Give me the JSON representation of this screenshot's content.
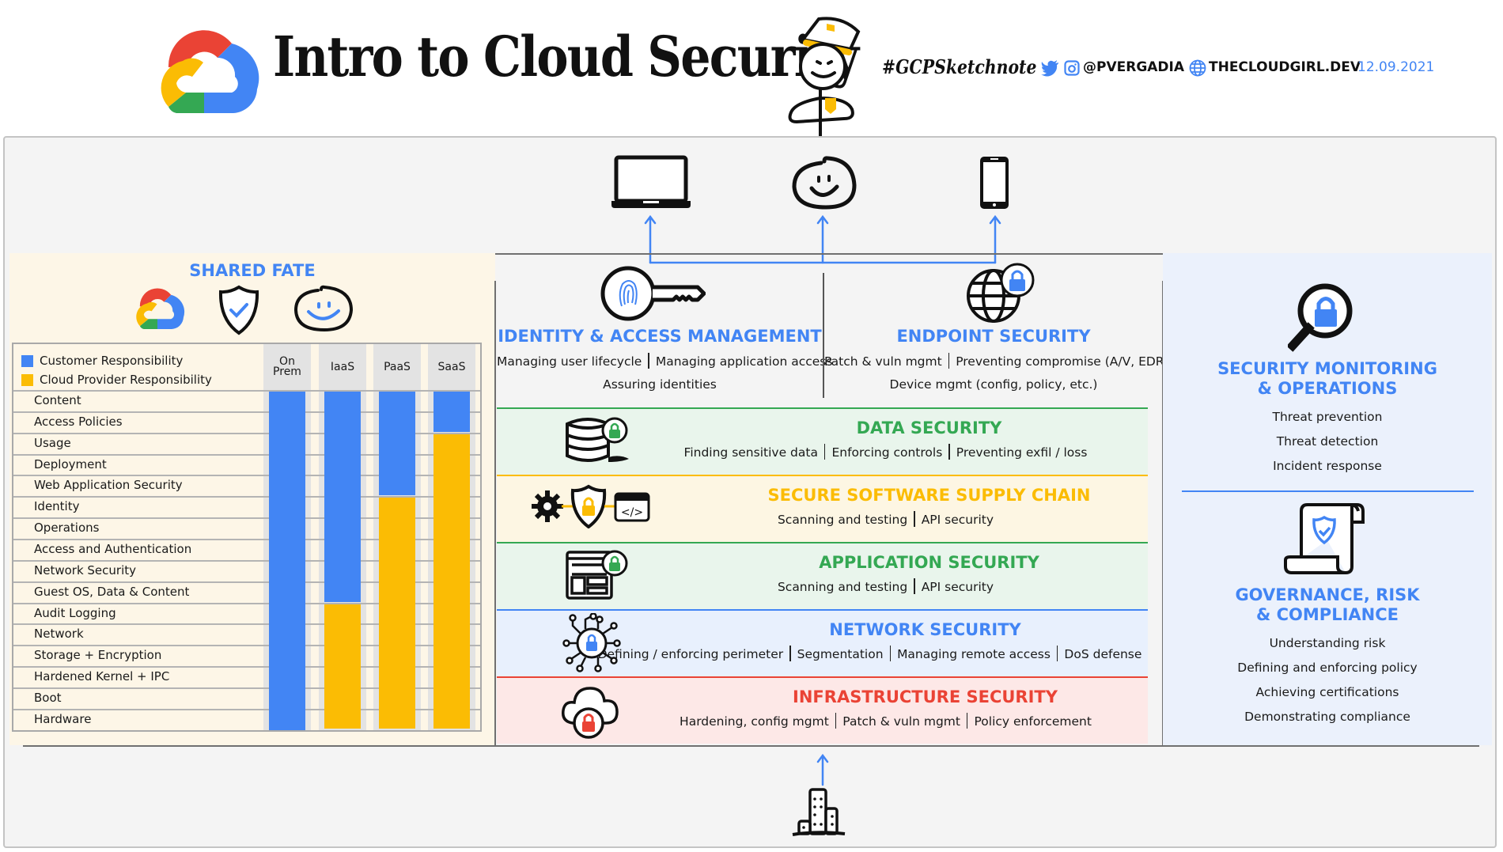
{
  "header": {
    "title": "Intro to Cloud Security",
    "hashtag": "#GCPSketchnote",
    "social_handle": "@PVERGADIA",
    "website": "THECLOUDGIRL.DEV",
    "date": "12.09.2021",
    "icons": [
      "google-cloud-logo-icon",
      "policeman-icon",
      "twitter-icon",
      "instagram-icon",
      "globe-icon"
    ]
  },
  "colors": {
    "blue": "#4285f4",
    "yellow": "#fbbc04",
    "green": "#34a853",
    "red": "#ea4335",
    "customer": "#4285f4",
    "provider": "#fbbc04"
  },
  "top_devices": {
    "items": [
      "laptop",
      "user",
      "mobile-phone"
    ]
  },
  "shared_fate": {
    "title": "SHARED FATE",
    "icons": [
      "google-cloud-logo-icon",
      "shield-check-icon",
      "smiley-user-icon"
    ],
    "legend": {
      "customer": "Customer Responsibility",
      "provider": "Cloud Provider Responsibility"
    },
    "columns": [
      "On Prem",
      "IaaS",
      "PaaS",
      "SaaS"
    ],
    "rows": [
      "Content",
      "Access Policies",
      "Usage",
      "Deployment",
      "Web Application Security",
      "Identity",
      "Operations",
      "Access and Authentication",
      "Network Security",
      "Guest OS, Data & Content",
      "Audit Logging",
      "Network",
      "Storage + Encryption",
      "Hardened Kernel + IPC",
      "Boot",
      "Hardware"
    ],
    "customer_rows_per_model": {
      "On Prem": 16,
      "IaaS": 10,
      "PaaS": 5,
      "SaaS": 2
    }
  },
  "iam": {
    "title": "IDENTITY & ACCESS MANAGEMENT",
    "line1": [
      "Managing user lifecycle",
      "Managing application access"
    ],
    "line2": "Assuring identities"
  },
  "endpoint": {
    "title": "ENDPOINT SECURITY",
    "line1": [
      "Patch & vuln mgmt",
      "Preventing compromise (A/V, EDR)"
    ],
    "line2": "Device mgmt (config, policy, etc.)"
  },
  "bands": [
    {
      "title": "DATA SECURITY",
      "items": [
        "Finding sensitive data",
        "Enforcing controls",
        "Preventing exfil / loss"
      ],
      "icon": "database-lock-icon"
    },
    {
      "title": "SECURE SOFTWARE SUPPLY CHAIN",
      "items": [
        "Scanning and testing",
        "API security"
      ],
      "icon": "gear-shield-code-icon"
    },
    {
      "title": "APPLICATION SECURITY",
      "items": [
        "Scanning and testing",
        "API security"
      ],
      "icon": "app-window-lock-icon"
    },
    {
      "title": "NETWORK SECURITY",
      "items": [
        "Defining / enforcing perimeter",
        "Segmentation",
        "Managing remote access",
        "DoS defense"
      ],
      "icon": "network-lock-icon"
    },
    {
      "title": "INFRASTRUCTURE SECURITY",
      "items": [
        "Hardening, config mgmt",
        "Patch & vuln mgmt",
        "Policy enforcement"
      ],
      "icon": "cloud-lock-icon"
    }
  ],
  "monitoring": {
    "title_line1": "SECURITY MONITORING",
    "title_line2": "& OPERATIONS",
    "items": [
      "Threat prevention",
      "Threat detection",
      "Incident response"
    ]
  },
  "grc": {
    "title_line1": "GOVERNANCE, RISK",
    "title_line2": "& COMPLIANCE",
    "items": [
      "Understanding risk",
      "Defining and enforcing policy",
      "Achieving certifications",
      "Demonstrating compliance"
    ]
  },
  "bottom": {
    "icon": "buildings-icon"
  }
}
